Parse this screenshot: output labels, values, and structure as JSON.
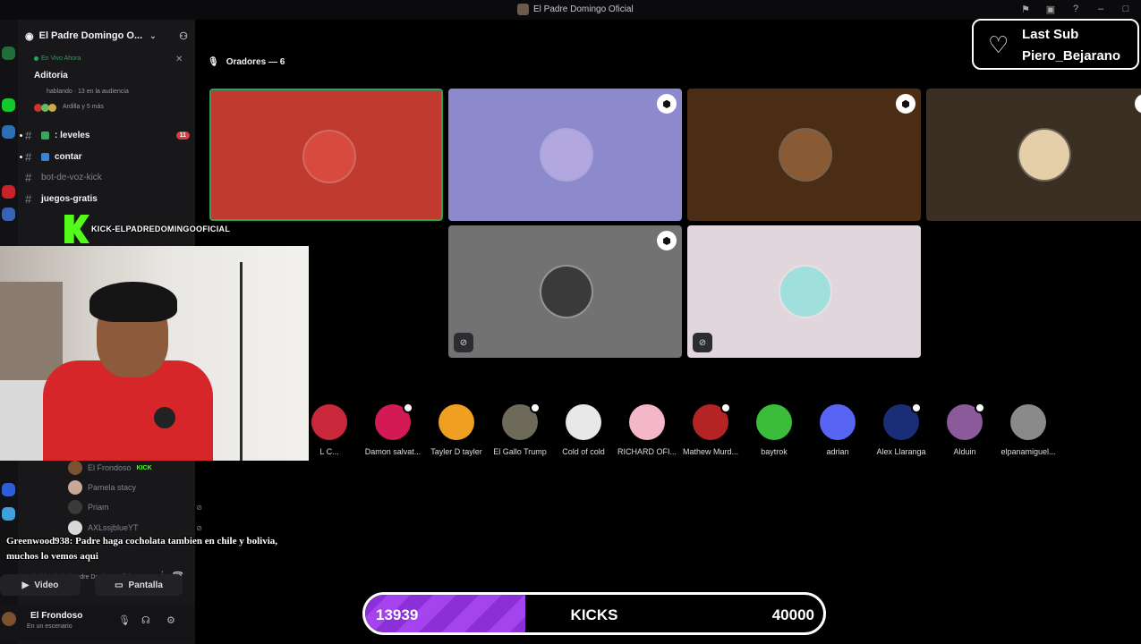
{
  "window": {
    "title": "El Padre Domingo Oficial"
  },
  "server": {
    "name": "El Padre Domingo O..."
  },
  "live_stage": {
    "status": "En Vivo Ahora",
    "name": "Aditoria",
    "meta": "hablando · 13 en la audiencia",
    "listeners": "Ardilla y 5 más"
  },
  "channels": [
    {
      "name": ": leveles",
      "unread": true,
      "badge": "11"
    },
    {
      "name": "contar",
      "unread": true,
      "badge": ""
    },
    {
      "name": "bot-de-voz-kick",
      "unread": false,
      "badge": ""
    },
    {
      "name": "juegos-gratis",
      "unread": true,
      "badge": ""
    }
  ],
  "kick_banner": "KICK-ELPADREDOMINGOOFICIAL",
  "voice_users": [
    {
      "name": "El Frondoso",
      "tag": "KICK",
      "color": "#7a5230",
      "muted": false
    },
    {
      "name": "Pamela stacy",
      "tag": "",
      "color": "#c9a89a",
      "muted": false
    },
    {
      "name": "Priam",
      "tag": "",
      "color": "#3a3a3a",
      "muted": true
    },
    {
      "name": "AXLssjblueYT",
      "tag": "",
      "color": "#d8d8d8",
      "muted": true
    }
  ],
  "voice_status": "hablando / El Padre Domingo Ofici...",
  "buttons": {
    "video": "Video",
    "screen": "Pantalla"
  },
  "user_panel": {
    "name": "El Frondoso",
    "status": "En un escenario"
  },
  "stage": {
    "speakers_label": "Oradores — 6"
  },
  "speaker_tiles": [
    {
      "bg": "#c13a2f",
      "avatar": "#d94a3e",
      "mod": false,
      "muted": false,
      "active": true
    },
    {
      "bg": "#8c89cc",
      "avatar": "#b2a7e0",
      "mod": true,
      "muted": false,
      "active": false
    },
    {
      "bg": "#4a2d14",
      "avatar": "#8a5a35",
      "mod": true,
      "muted": false,
      "active": false
    },
    {
      "bg": "#3b2f24",
      "avatar": "#e4cfa9",
      "mod": true,
      "muted": false,
      "active": false
    },
    {
      "bg": "#727272",
      "avatar": "#3a3a3a",
      "mod": true,
      "muted": true,
      "active": false
    },
    {
      "bg": "#e0d6db",
      "avatar": "#9fe0dc",
      "mod": false,
      "muted": true,
      "active": false
    }
  ],
  "audience": [
    {
      "name": "L C...",
      "color": "#c9283a",
      "ring": false
    },
    {
      "name": "Damon salvat...",
      "color": "#d41a55",
      "ring": true
    },
    {
      "name": "Tayler D tayler",
      "color": "#f0a020",
      "ring": false
    },
    {
      "name": "El Gallo Trump",
      "color": "#6e6a5a",
      "ring": true
    },
    {
      "name": "Cold of cold",
      "color": "#e8e8e8",
      "ring": false
    },
    {
      "name": "RICHARD OFI...",
      "color": "#f3b7c8",
      "ring": false
    },
    {
      "name": "Mathew Murd...",
      "color": "#b52424",
      "ring": true
    },
    {
      "name": "baytrok",
      "color": "#3bbd3b",
      "ring": false
    },
    {
      "name": "adrian",
      "color": "#5865f2",
      "ring": false
    },
    {
      "name": "Alex Llaranga",
      "color": "#1a2e78",
      "ring": true
    },
    {
      "name": "Alduin",
      "color": "#8a5a9a",
      "ring": true
    },
    {
      "name": "elpanamiguel...",
      "color": "#8a8a8a",
      "ring": false
    }
  ],
  "last_sub": {
    "label": "Last Sub",
    "user": "Piero_Bejarano"
  },
  "chat_overlay": "Greenwood938: Padre haga cocholata tambien en chile y bolivia, muchos lo vemos aqui",
  "kicks_goal": {
    "current": "13939",
    "label": "KICKS",
    "goal": "40000",
    "progress": 0.35
  }
}
